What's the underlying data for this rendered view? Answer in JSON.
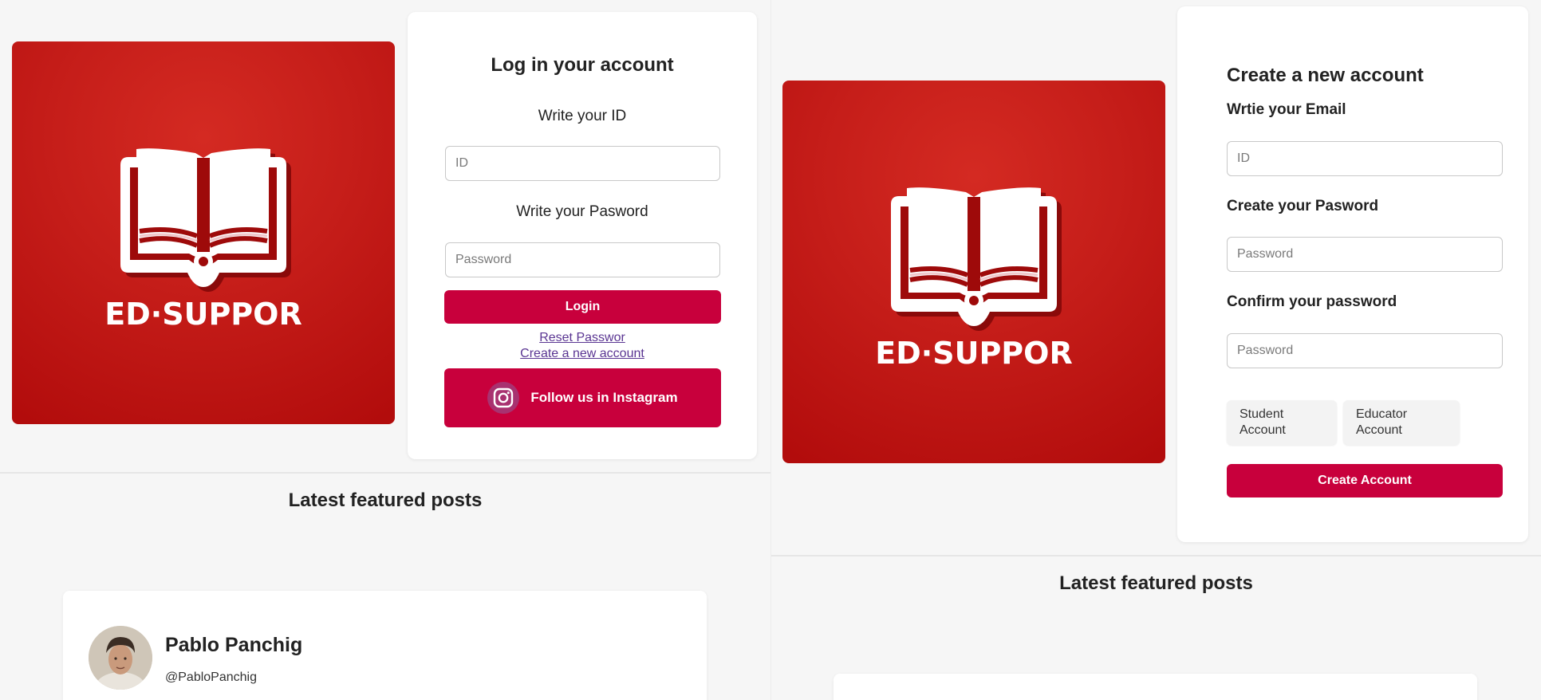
{
  "brand": {
    "name": "ED·SUPPOR",
    "accent": "#c8003c",
    "logo_red": "#c51d19"
  },
  "login": {
    "title": "Log in your account",
    "id_label": "Write your ID",
    "id_placeholder": "ID",
    "password_label": "Write your Pasword",
    "password_placeholder": "Password",
    "login_button": "Login",
    "reset_link": "Reset Passwor",
    "create_link": "Create a new account",
    "instagram_button": "Follow us in Instagram",
    "instagram_icon": "instagram-icon"
  },
  "feed_left": {
    "heading": "Latest featured posts",
    "post": {
      "name": "Pablo Panchig",
      "handle": "@PabloPanchig"
    }
  },
  "signup": {
    "title": "Create a new account",
    "email_label": "Wrtie your Email",
    "email_placeholder": "ID",
    "password_label": "Create your Pasword",
    "password_placeholder": "Password",
    "confirm_label": "Confirm your password",
    "confirm_placeholder": "Password",
    "student_button": "Student Account",
    "educator_button": "Educator Account",
    "create_button": "Create Account"
  },
  "feed_right": {
    "heading": "Latest featured posts"
  }
}
